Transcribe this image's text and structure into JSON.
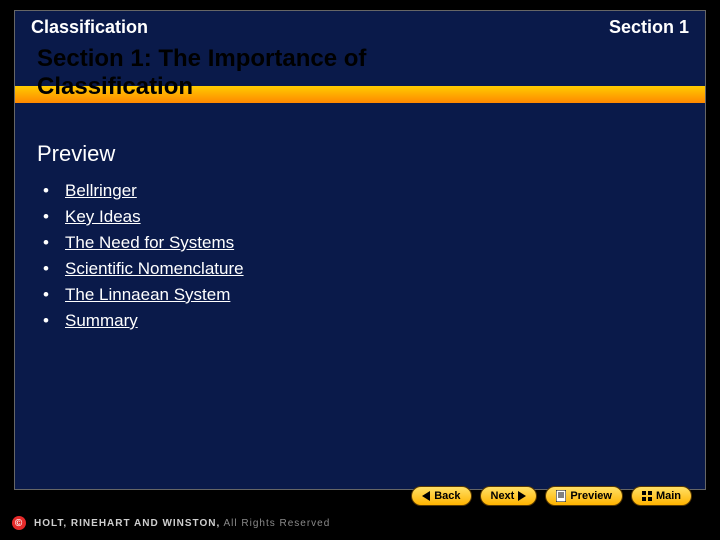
{
  "header": {
    "left": "Classification",
    "right": "Section 1"
  },
  "title": "Section 1: The Importance of Classification",
  "subhead": "Preview",
  "items": [
    "Bellringer",
    "Key Ideas",
    "The Need for Systems",
    "Scientific Nomenclature",
    "The Linnaean System",
    "Summary"
  ],
  "nav": {
    "back": "Back",
    "next": "Next",
    "preview": "Preview",
    "main": "Main"
  },
  "copyright": {
    "brand": "HOLT, RINEHART AND WINSTON,",
    "tail": " All Rights Reserved"
  }
}
